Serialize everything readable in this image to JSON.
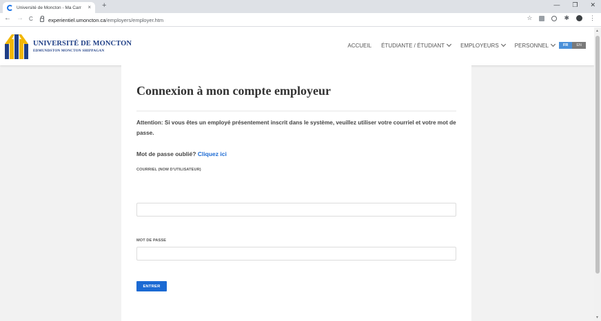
{
  "browser": {
    "tab_title": "Université de Moncton - Ma Carr",
    "tab_close": "×",
    "new_tab": "+",
    "win_minimize": "—",
    "win_restore": "❐",
    "win_close": "✕",
    "back": "←",
    "forward": "→",
    "reload": "C",
    "url_host": "experientiel.umoncton.ca",
    "url_path": "/employers/employer.htm",
    "star": "☆",
    "puzzle": "✱",
    "menu": "⋮"
  },
  "site": {
    "logo_line1": "UNIVERSITÉ DE MONCTON",
    "logo_line2": "EDMUNDSTON  MONCTON  SHIPPAGAN",
    "colors": {
      "brand_blue": "#1f3f86",
      "brand_yellow": "#f2b705",
      "link": "#1b6ad3"
    }
  },
  "nav": {
    "items": [
      {
        "label": "ACCUEIL"
      },
      {
        "label": "ÉTUDIANTE / ÉTUDIANT"
      },
      {
        "label": "EMPLOYEURS"
      },
      {
        "label": "PERSONNEL"
      }
    ],
    "lang_fr": "FR",
    "lang_en": "EN"
  },
  "form": {
    "title": "Connexion à mon compte employeur",
    "attention": "Attention: Si vous êtes un employé présentement inscrit dans le système, veuillez utiliser votre courriel et votre mot de passe.",
    "forgot_prefix": "Mot de passe oublié?",
    "forgot_link": "Cliquez ici",
    "email_label": "COURRIEL (NOM D'UTILISATEUR)",
    "email_value": "",
    "password_label": "MOT DE PASSE",
    "password_value": "",
    "submit_label": "ENTRER"
  }
}
